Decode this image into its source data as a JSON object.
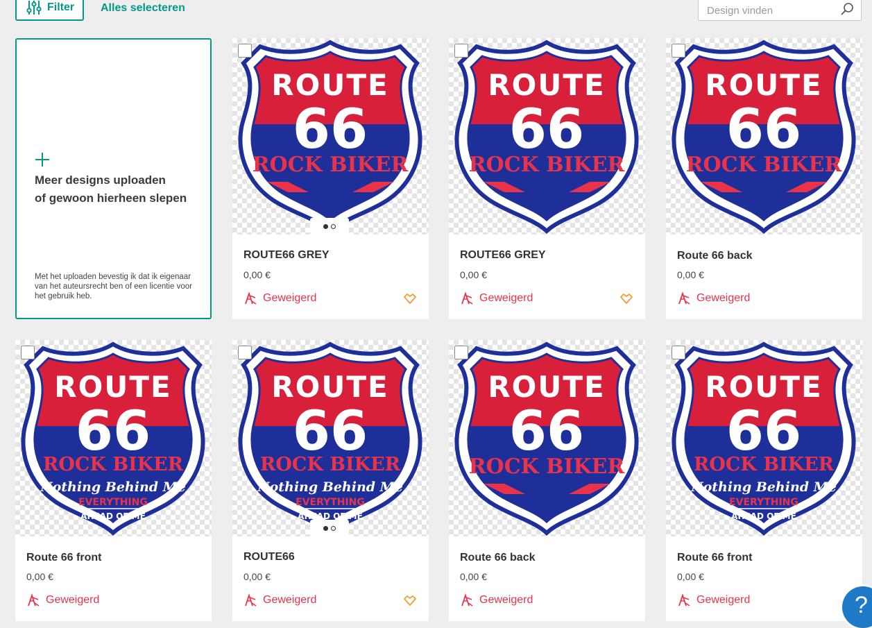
{
  "toolbar": {
    "filter_label": "Filter",
    "select_all_label": "Alles selecteren",
    "search_placeholder": "Design vinden",
    "search_value": ""
  },
  "upload": {
    "title_line1": "Meer designs uploaden",
    "title_line2": "of gewoon hierheen slepen",
    "note": "Met het uploaden bevestig ik dat ik eigenaar van het auteursrecht ben of een licentie voor het gebruik heb."
  },
  "designs": [
    {
      "title": "ROUTE66 GREY",
      "price": "0,00 €",
      "status": "Geweigerd",
      "variant": "shield",
      "has_dots": true,
      "favorite": true
    },
    {
      "title": "ROUTE66 GREY",
      "price": "0,00 €",
      "status": "Geweigerd",
      "variant": "shield",
      "has_dots": false,
      "favorite": true
    },
    {
      "title": "Route 66 back",
      "price": "0,00 €",
      "status": "Geweigerd",
      "variant": "shield",
      "has_dots": false,
      "favorite": false
    },
    {
      "title": "Route 66 front",
      "price": "0,00 €",
      "status": "Geweigerd",
      "variant": "slogan",
      "has_dots": false,
      "favorite": false
    },
    {
      "title": "ROUTE66",
      "price": "0,00 €",
      "status": "Geweigerd",
      "variant": "slogan",
      "has_dots": true,
      "favorite": true
    },
    {
      "title": "Route 66 back",
      "price": "0,00 €",
      "status": "Geweigerd",
      "variant": "shield",
      "has_dots": false,
      "favorite": false
    },
    {
      "title": "Route 66 front",
      "price": "0,00 €",
      "status": "Geweigerd",
      "variant": "slogan",
      "has_dots": false,
      "favorite": false
    }
  ],
  "artwork": {
    "line1": "ROUTE",
    "line2": "66",
    "line3": "ROCK BIKER",
    "slogan1": "Nothing Behind Me",
    "slogan2": "EVERYTHING",
    "slogan3": "AHEAD OF ME"
  },
  "help_label": "?",
  "colors": {
    "accent": "#00998a",
    "rejected": "#e8334a",
    "favorite": "#f39c34",
    "shield_red": "#d9203a",
    "shield_blue": "#1f2f9a",
    "help": "#1e7ac8"
  },
  "icons": {
    "filter": "sliders-icon",
    "search": "magnifier-icon",
    "add": "plus-icon",
    "rejected": "rejected-icon",
    "favorite": "diamond-heart-icon",
    "help": "question-icon"
  }
}
